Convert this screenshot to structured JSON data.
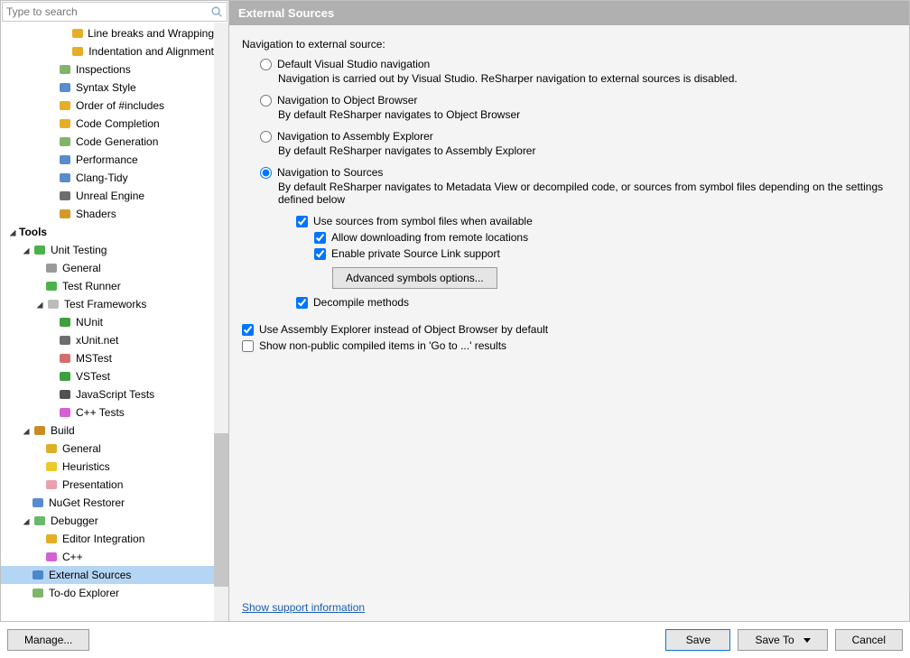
{
  "search": {
    "placeholder": "Type to search"
  },
  "tree": {
    "items": [
      {
        "indent": 4,
        "icon": "#e0a000",
        "label": "Line breaks and Wrapping"
      },
      {
        "indent": 4,
        "icon": "#e0a000",
        "label": "Indentation and Alignment"
      },
      {
        "indent": 3,
        "icon": "#6aa84f",
        "label": "Inspections"
      },
      {
        "indent": 3,
        "icon": "#3b78c3",
        "label": "Syntax Style"
      },
      {
        "indent": 3,
        "icon": "#e0a000",
        "label": "Order of #includes"
      },
      {
        "indent": 3,
        "icon": "#e0a000",
        "label": "Code Completion"
      },
      {
        "indent": 3,
        "icon": "#6aa84f",
        "label": "Code Generation"
      },
      {
        "indent": 3,
        "icon": "#3b78c3",
        "label": "Performance"
      },
      {
        "indent": 3,
        "icon": "#3b78c3",
        "label": "Clang-Tidy"
      },
      {
        "indent": 3,
        "icon": "#555",
        "label": "Unreal Engine"
      },
      {
        "indent": 3,
        "icon": "#cc8800",
        "label": "Shaders"
      },
      {
        "indent": 0,
        "arrow": true,
        "bold": true,
        "label": "Tools"
      },
      {
        "indent": 1,
        "arrow": true,
        "icon": "#2aa52a",
        "label": "Unit Testing"
      },
      {
        "indent": 2,
        "icon": "#888",
        "label": "General"
      },
      {
        "indent": 2,
        "icon": "#2aa52a",
        "label": "Test Runner"
      },
      {
        "indent": 2,
        "arrow": true,
        "icon": "#b0b0b0",
        "label": "Test Frameworks"
      },
      {
        "indent": 3,
        "icon": "#1b8f1b",
        "label": "NUnit"
      },
      {
        "indent": 3,
        "icon": "#555",
        "label": "xUnit.net"
      },
      {
        "indent": 3,
        "icon": "#cc5555",
        "label": "MSTest"
      },
      {
        "indent": 3,
        "icon": "#1b8f1b",
        "label": "VSTest"
      },
      {
        "indent": 3,
        "icon": "#333",
        "label": "JavaScript Tests"
      },
      {
        "indent": 3,
        "icon": "#cc44cc",
        "label": "C++ Tests"
      },
      {
        "indent": 1,
        "arrow": true,
        "icon": "#c07700",
        "label": "Build"
      },
      {
        "indent": 2,
        "icon": "#d8a000",
        "label": "General"
      },
      {
        "indent": 2,
        "icon": "#e8c000",
        "label": "Heuristics"
      },
      {
        "indent": 2,
        "icon": "#e88fa0",
        "label": "Presentation"
      },
      {
        "indent": 1,
        "icon": "#3b78c3",
        "label": "NuGet Restorer"
      },
      {
        "indent": 1,
        "arrow": true,
        "icon": "#4cae4c",
        "label": "Debugger"
      },
      {
        "indent": 2,
        "icon": "#e0a000",
        "label": "Editor Integration"
      },
      {
        "indent": 2,
        "icon": "#cc44cc",
        "label": "C++"
      },
      {
        "indent": 1,
        "icon": "#3b78c3",
        "label": "External Sources",
        "selected": true
      },
      {
        "indent": 1,
        "icon": "#6aa84f",
        "label": "To-do Explorer"
      }
    ]
  },
  "header": {
    "title": "External Sources"
  },
  "body": {
    "nav_label": "Navigation to external source:",
    "radios": [
      {
        "label": "Default Visual Studio navigation",
        "desc": "Navigation is carried out by Visual Studio. ReSharper navigation to external sources is disabled.",
        "checked": false
      },
      {
        "label": "Navigation to Object Browser",
        "desc": "By default ReSharper navigates to Object Browser",
        "checked": false
      },
      {
        "label": "Navigation to Assembly Explorer",
        "desc": "By default ReSharper navigates to Assembly Explorer",
        "checked": false
      },
      {
        "label": "Navigation to Sources",
        "desc": "By default ReSharper navigates to Metadata View or decompiled code, or sources from symbol files depending on the settings defined below",
        "checked": true
      }
    ],
    "sources_checks": {
      "use_sources": {
        "label": "Use sources from symbol files when available",
        "checked": true
      },
      "allow_download": {
        "label": "Allow downloading from remote locations",
        "checked": true
      },
      "private_link": {
        "label": "Enable private Source Link support",
        "checked": true
      },
      "adv_button": "Advanced symbols options...",
      "decompile": {
        "label": "Decompile methods",
        "checked": true
      }
    },
    "bottom_checks": {
      "use_asm": {
        "label": "Use Assembly Explorer instead of Object Browser by default",
        "checked": true
      },
      "show_nonpublic": {
        "label": "Show non-public compiled items in 'Go to ...' results",
        "checked": false
      }
    },
    "support_link": "Show support information"
  },
  "footer": {
    "manage": "Manage...",
    "save": "Save",
    "save_to": "Save To",
    "cancel": "Cancel"
  }
}
